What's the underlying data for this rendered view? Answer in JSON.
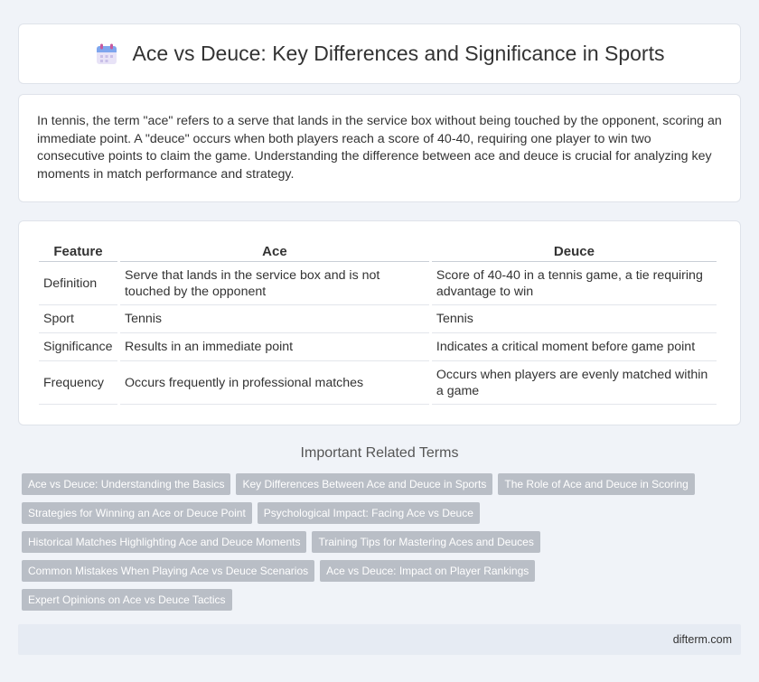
{
  "header": {
    "title": "Ace vs Deuce: Key Differences and Significance in Sports",
    "icon": "calendar-icon"
  },
  "intro": {
    "text": "In tennis, the term \"ace\" refers to a serve that lands in the service box without being touched by the opponent, scoring an immediate point. A \"deuce\" occurs when both players reach a score of 40-40, requiring one player to win two consecutive points to claim the game. Understanding the difference between ace and deuce is crucial for analyzing key moments in match performance and strategy."
  },
  "table": {
    "headers": [
      "Feature",
      "Ace",
      "Deuce"
    ],
    "rows": [
      [
        "Definition",
        "Serve that lands in the service box and is not touched by the opponent",
        "Score of 40-40 in a tennis game, a tie requiring advantage to win"
      ],
      [
        "Sport",
        "Tennis",
        "Tennis"
      ],
      [
        "Significance",
        "Results in an immediate point",
        "Indicates a critical moment before game point"
      ],
      [
        "Frequency",
        "Occurs frequently in professional matches",
        "Occurs when players are evenly matched within a game"
      ]
    ]
  },
  "related": {
    "title": "Important Related Terms",
    "tags": [
      "Ace vs Deuce: Understanding the Basics",
      "Key Differences Between Ace and Deuce in Sports",
      "The Role of Ace and Deuce in Scoring",
      "Strategies for Winning an Ace or Deuce Point",
      "Psychological Impact: Facing Ace vs Deuce",
      "Historical Matches Highlighting Ace and Deuce Moments",
      "Training Tips for Mastering Aces and Deuces",
      "Common Mistakes When Playing Ace vs Deuce Scenarios",
      "Ace vs Deuce: Impact on Player Rankings",
      "Expert Opinions on Ace vs Deuce Tactics"
    ]
  },
  "footer": {
    "site": "difterm.com"
  }
}
